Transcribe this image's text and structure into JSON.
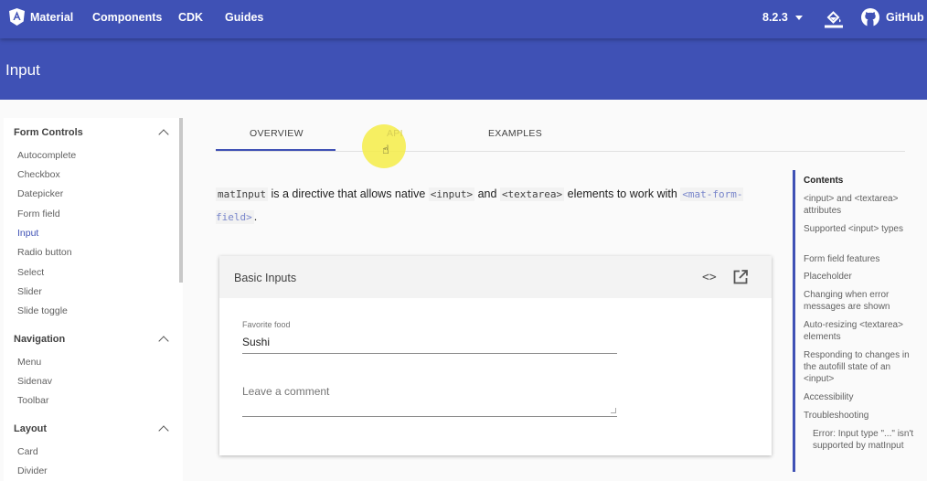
{
  "topbar": {
    "brand": "Material",
    "links": [
      "Components",
      "CDK",
      "Guides"
    ],
    "version": "8.2.3",
    "theme_icon": "format-color-fill-icon",
    "github": "GitHub"
  },
  "header": {
    "title": "Input"
  },
  "sidenav": {
    "groups": [
      {
        "title": "Form Controls",
        "items": [
          "Autocomplete",
          "Checkbox",
          "Datepicker",
          "Form field",
          "Input",
          "Radio button",
          "Select",
          "Slider",
          "Slide toggle"
        ]
      },
      {
        "title": "Navigation",
        "items": [
          "Menu",
          "Sidenav",
          "Toolbar"
        ]
      },
      {
        "title": "Layout",
        "items": [
          "Card",
          "Divider"
        ]
      }
    ],
    "active_item": "Input"
  },
  "tabs": [
    "OVERVIEW",
    "API",
    "EXAMPLES"
  ],
  "active_tab": "OVERVIEW",
  "intro": {
    "code1": "matInput",
    "text1": " is a directive that allows native ",
    "code2": "<input>",
    "text2": " and ",
    "code3": "<textarea>",
    "text3": " elements to work with ",
    "code4": "<mat-form-field>",
    "text4": "."
  },
  "example": {
    "title": "Basic Inputs",
    "code_icon": "<>",
    "favorite_label": "Favorite food",
    "favorite_value": "Sushi",
    "comment_placeholder": "Leave a comment"
  },
  "toc": {
    "title": "Contents",
    "items": [
      "<input> and <textarea> attributes",
      "Supported <input> types",
      "Form field features",
      "Placeholder",
      "Changing when error messages are shown",
      "Auto-resizing <textarea> elements",
      "Responding to changes in the autofill state of an <input>",
      "Accessibility",
      "Troubleshooting"
    ],
    "sub_item": "Error: Input type \"...\" isn't supported by matInput"
  }
}
